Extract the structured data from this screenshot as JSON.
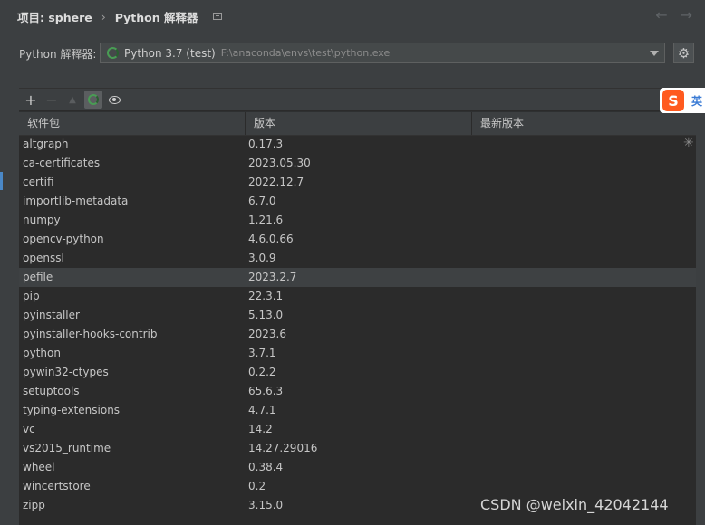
{
  "breadcrumb": {
    "project": "项目: sphere",
    "separator": "›",
    "page": "Python 解释器"
  },
  "nav": {
    "back": "←",
    "forward": "→"
  },
  "interpreter": {
    "label": "Python 解释器:",
    "name": "Python 3.7 (test)",
    "path": "F:\\anaconda\\envs\\test\\python.exe"
  },
  "toolbar": {
    "add": "+",
    "remove": "−",
    "upgrade": "▲"
  },
  "table": {
    "columns": [
      "软件包",
      "版本",
      "最新版本"
    ],
    "rows": [
      {
        "name": "altgraph",
        "version": "0.17.3"
      },
      {
        "name": "ca-certificates",
        "version": "2023.05.30"
      },
      {
        "name": "certifi",
        "version": "2022.12.7"
      },
      {
        "name": "importlib-metadata",
        "version": "6.7.0"
      },
      {
        "name": "numpy",
        "version": "1.21.6"
      },
      {
        "name": "opencv-python",
        "version": "4.6.0.66"
      },
      {
        "name": "openssl",
        "version": "3.0.9"
      },
      {
        "name": "pefile",
        "version": "2023.2.7"
      },
      {
        "name": "pip",
        "version": "22.3.1"
      },
      {
        "name": "pyinstaller",
        "version": "5.13.0"
      },
      {
        "name": "pyinstaller-hooks-contrib",
        "version": "2023.6"
      },
      {
        "name": "python",
        "version": "3.7.1"
      },
      {
        "name": "pywin32-ctypes",
        "version": "0.2.2"
      },
      {
        "name": "setuptools",
        "version": "65.6.3"
      },
      {
        "name": "typing-extensions",
        "version": "4.7.1"
      },
      {
        "name": "vc",
        "version": "14.2"
      },
      {
        "name": "vs2015_runtime",
        "version": "14.27.29016"
      },
      {
        "name": "wheel",
        "version": "0.38.4"
      },
      {
        "name": "wincertstore",
        "version": "0.2"
      },
      {
        "name": "zipp",
        "version": "3.15.0"
      }
    ],
    "selected_index": 7
  },
  "ime": {
    "logo": "S",
    "text": "英"
  },
  "watermark": "CSDN @weixin_42042144",
  "colors": {
    "background": "#3c3f41",
    "table_bg": "#2b2b2b",
    "accent": "#499c54",
    "selected_row": "#3e4143"
  }
}
